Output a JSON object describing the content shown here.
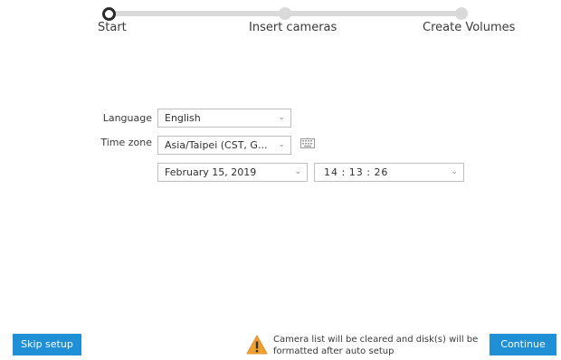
{
  "wizard": {
    "steps": [
      {
        "label": "Start",
        "active": true
      },
      {
        "label": "Insert cameras",
        "active": false
      },
      {
        "label": "Create Volumes",
        "active": false
      }
    ]
  },
  "form": {
    "language": {
      "label": "Language",
      "value": "English"
    },
    "timezone": {
      "label": "Time zone",
      "value": "Asia/Taipei (CST, G..."
    },
    "date": {
      "value": "February 15, 2019"
    },
    "time": {
      "hours": "14",
      "minutes": "13",
      "seconds": "26"
    }
  },
  "footer": {
    "skip_label": "Skip setup",
    "warning_line1": "Camera list will be cleared and disk(s) will be",
    "warning_line2": "formatted after auto setup",
    "continue_label": "Continue"
  },
  "colors": {
    "accent": "#1f90d6",
    "warning": "#f0a030"
  },
  "icons": {
    "keyboard": "keyboard-icon",
    "warning": "warning-icon",
    "dropdown": "chevron-down-icon"
  }
}
